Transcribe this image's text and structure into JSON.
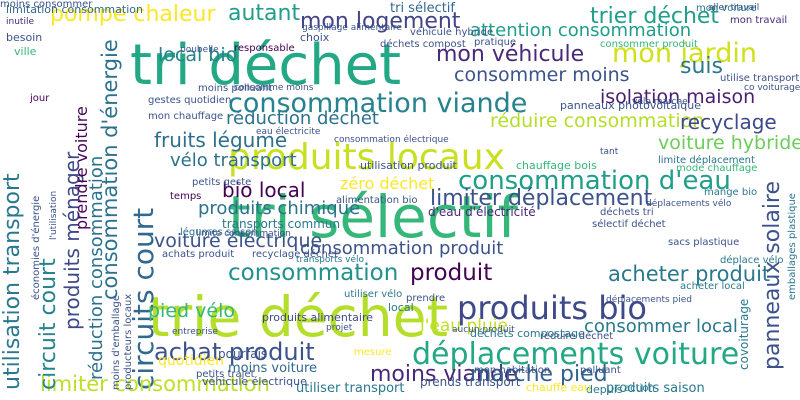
{
  "words": [
    {
      "text": "tri déchet",
      "color": "#22a884"
    },
    {
      "text": "tri sélectif",
      "color": "#35b779"
    },
    {
      "text": "trie déchet",
      "color": "#b5de2b"
    },
    {
      "text": "produits locaux",
      "color": "#c8e020"
    },
    {
      "text": "consommation viande",
      "color": "#26828e"
    },
    {
      "text": "déplacements voiture",
      "color": "#22a884"
    },
    {
      "text": "circuits court",
      "color": "#31688e"
    },
    {
      "text": "produits bio",
      "color": "#3e4989"
    },
    {
      "text": "mon logement",
      "color": "#414487"
    },
    {
      "text": "consommation d'eau",
      "color": "#1f9e89"
    },
    {
      "text": "pompe chaleur",
      "color": "#fde725"
    },
    {
      "text": "autant",
      "color": "#1f9e89"
    },
    {
      "text": "trier déchet",
      "color": "#1f9e89"
    },
    {
      "text": "mon jardin",
      "color": "#d0e11c"
    },
    {
      "text": "consommation",
      "color": "#21918c"
    },
    {
      "text": "produit",
      "color": "#440154"
    },
    {
      "text": "acheter produit",
      "color": "#2a788e"
    },
    {
      "text": "moins viande",
      "color": "#482878"
    },
    {
      "text": "marche pied",
      "color": "#33638d"
    },
    {
      "text": "achat produit",
      "color": "#3b528b"
    },
    {
      "text": "limiter consommation",
      "color": "#bddf26"
    },
    {
      "text": "limiter déplacement",
      "color": "#3b528b"
    },
    {
      "text": "consommation d'énergie",
      "color": "#2c728e"
    },
    {
      "text": "utilisation transport",
      "color": "#2a788e"
    },
    {
      "text": "circuit court",
      "color": "#25848e"
    },
    {
      "text": "produits ménager",
      "color": "#3e4989"
    },
    {
      "text": "réduction consommation",
      "color": "#2c728e"
    },
    {
      "text": "prendre voiture",
      "color": "#450457"
    },
    {
      "text": "panneaux solaire",
      "color": "#3b528b"
    },
    {
      "text": "mon véhicule",
      "color": "#482878"
    },
    {
      "text": "consommer moins",
      "color": "#3b528b"
    },
    {
      "text": "local bio",
      "color": "#26828e"
    },
    {
      "text": "attention consommation",
      "color": "#1f9e89"
    },
    {
      "text": "suis",
      "color": "#2a788e"
    },
    {
      "text": "isolation maison",
      "color": "#481f70"
    },
    {
      "text": "réduire consommation",
      "color": "#b5de2b"
    },
    {
      "text": "recyclage",
      "color": "#3e4989"
    },
    {
      "text": "réduction déchet",
      "color": "#2c728e"
    },
    {
      "text": "fruits légume",
      "color": "#2d708e"
    },
    {
      "text": "voiture hybride",
      "color": "#6ccd5a"
    },
    {
      "text": "vélo transport",
      "color": "#2d708e"
    },
    {
      "text": "bio local",
      "color": "#440154"
    },
    {
      "text": "zéro déchet",
      "color": "#fde725"
    },
    {
      "text": "produits chimique",
      "color": "#2c728e"
    },
    {
      "text": "voiture électrique",
      "color": "#3b528b"
    },
    {
      "text": "consommation produit",
      "color": "#3b528b"
    },
    {
      "text": "pied vélo",
      "color": "#35b779"
    },
    {
      "text": "consommer local",
      "color": "#2a788e"
    },
    {
      "text": "l'eau pluie",
      "color": "#c2df23"
    },
    {
      "text": "mon chauffage",
      "color": "#3b528b"
    },
    {
      "text": "moins voiture",
      "color": "#31688e"
    },
    {
      "text": "quotidien",
      "color": "#fde725"
    },
    {
      "text": "produits alimentaire",
      "color": "#3e4989"
    },
    {
      "text": "transports commun",
      "color": "#2a788e"
    },
    {
      "text": "déchets tri",
      "color": "#3b528b"
    },
    {
      "text": "mange bio",
      "color": "#2a788e"
    },
    {
      "text": "sélectif déchet",
      "color": "#3b528b"
    },
    {
      "text": "d'eau d'électricité",
      "color": "#482878"
    },
    {
      "text": "achats produit",
      "color": "#3b528b"
    },
    {
      "text": "recyclage déchet",
      "color": "#3b528b"
    },
    {
      "text": "légumes saison",
      "color": "#2c728e"
    },
    {
      "text": "prends transport",
      "color": "#3b528b"
    },
    {
      "text": "produits saison",
      "color": "#2a788e"
    },
    {
      "text": "utiliser transport",
      "color": "#2a788e"
    },
    {
      "text": "véhicule électrique",
      "color": "#3b528b"
    },
    {
      "text": "déchets compostage",
      "color": "#2a788e"
    },
    {
      "text": "covoiturage",
      "color": "#2a788e"
    },
    {
      "text": "emballages plastique",
      "color": "#2a788e"
    },
    {
      "text": "limitation consommation",
      "color": "#31688e"
    },
    {
      "text": "gestes quotidien",
      "color": "#3b528b"
    },
    {
      "text": "moins polluant",
      "color": "#3b528b"
    },
    {
      "text": "limite déplacement",
      "color": "#2c728e"
    },
    {
      "text": "consommer produit",
      "color": "#35b779"
    },
    {
      "text": "véhicule hybride",
      "color": "#3b528b"
    },
    {
      "text": "tri sélectif",
      "color": "#31688e"
    },
    {
      "text": "gaspillage alimentaire",
      "color": "#3b528b"
    },
    {
      "text": "déchets compost",
      "color": "#3b528b"
    },
    {
      "text": "utilisation produit",
      "color": "#3b528b"
    },
    {
      "text": "chauffage bois",
      "color": "#35b779"
    },
    {
      "text": "alimentation bio",
      "color": "#3b528b"
    },
    {
      "text": "transports vélo",
      "color": "#2a788e"
    },
    {
      "text": "mon voiture",
      "color": "#2a788e"
    },
    {
      "text": "mon travail",
      "color": "#482878"
    },
    {
      "text": "besoin",
      "color": "#3b528b"
    },
    {
      "text": "inutile",
      "color": "#482878"
    },
    {
      "text": "ville",
      "color": "#35b779"
    },
    {
      "text": "jour",
      "color": "#440154"
    },
    {
      "text": "temps",
      "color": "#440154"
    },
    {
      "text": "pratique",
      "color": "#3b528b"
    },
    {
      "text": "choix",
      "color": "#3b528b"
    },
    {
      "text": "responsable",
      "color": "#440154"
    },
    {
      "text": "poubelle",
      "color": "#3b528b"
    },
    {
      "text": "local",
      "color": "#2a788e"
    },
    {
      "text": "prendre",
      "color": "#3b528b"
    },
    {
      "text": "pourrais",
      "color": "#3b528b"
    },
    {
      "text": "mesure",
      "color": "#fde725"
    },
    {
      "text": "depuis",
      "color": "#2a788e"
    },
    {
      "text": "action",
      "color": "#2a788e"
    },
    {
      "text": "polluant",
      "color": "#3b528b"
    },
    {
      "text": "mode chauffage",
      "color": "#35b779"
    },
    {
      "text": "chauffe eau",
      "color": "#fde725"
    },
    {
      "text": "petits trajet",
      "color": "#3b528b"
    },
    {
      "text": "petits geste",
      "color": "#3b528b"
    },
    {
      "text": "consomme moins",
      "color": "#3b528b"
    },
    {
      "text": "sacs plastique",
      "color": "#3b528b"
    },
    {
      "text": "déplace vélo",
      "color": "#2a788e"
    },
    {
      "text": "acheter local",
      "color": "#2a788e"
    },
    {
      "text": "utiliser vélo",
      "color": "#2a788e"
    },
    {
      "text": "réduire déchet",
      "color": "#3b528b"
    },
    {
      "text": "mon habitation",
      "color": "#3b528b"
    },
    {
      "text": "panneaux photovoltaïque",
      "color": "#3b528b"
    },
    {
      "text": "producteurs locaux",
      "color": "#3b528b"
    },
    {
      "text": "moins d'emballage",
      "color": "#3b528b"
    },
    {
      "text": "l'utilisation",
      "color": "#3b528b"
    },
    {
      "text": "économies d'énergie",
      "color": "#3b528b"
    },
    {
      "text": "limite consommation",
      "color": "#3b528b"
    },
    {
      "text": "aucun produit",
      "color": "#3b528b"
    },
    {
      "text": "projet",
      "color": "#3b528b"
    },
    {
      "text": "tant",
      "color": "#3b528b"
    },
    {
      "text": "entreprise",
      "color": "#3b528b"
    },
    {
      "text": "eau électricite",
      "color": "#3b528b"
    },
    {
      "text": "consommation électrique",
      "color": "#3b528b"
    },
    {
      "text": "déplacements vélo",
      "color": "#3b528b"
    },
    {
      "text": "déplacements pied",
      "color": "#3b528b"
    },
    {
      "text": "utilise transport",
      "color": "#3b528b"
    },
    {
      "text": "co voiturage",
      "color": "#3b528b"
    },
    {
      "text": "aller travail",
      "color": "#3b528b"
    },
    {
      "text": "vélo marche",
      "color": "#3b528b"
    },
    {
      "text": "moins consommer",
      "color": "#3b528b"
    }
  ]
}
